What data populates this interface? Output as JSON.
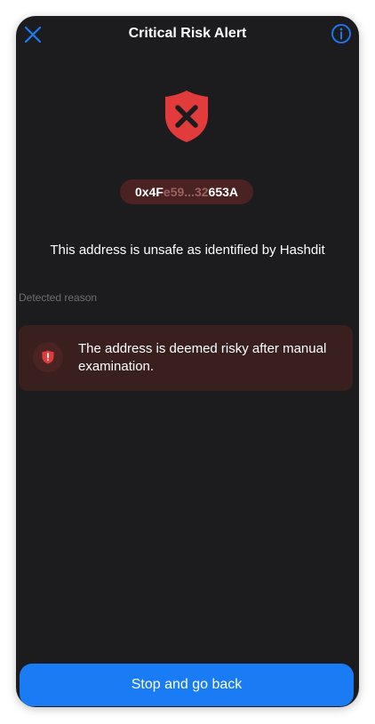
{
  "header": {
    "title": "Critical Risk Alert",
    "close_icon": "close-icon",
    "info_icon": "info-icon"
  },
  "alert": {
    "icon": "shield-x-icon",
    "address_prefix": "0x4F",
    "address_middle": "e59...32",
    "address_suffix": "653A",
    "message": "This address is unsafe as identified by Hashdit"
  },
  "detected": {
    "label": "Detected reason",
    "reasons": [
      {
        "icon": "shield-alert-icon",
        "text": "The address is deemed risky after manual examination."
      }
    ]
  },
  "footer": {
    "button_label": "Stop and go back"
  },
  "colors": {
    "background": "#1c1c1e",
    "danger": "#e23b3b",
    "accent": "#1a7cf5",
    "card": "#3a1f1f"
  }
}
